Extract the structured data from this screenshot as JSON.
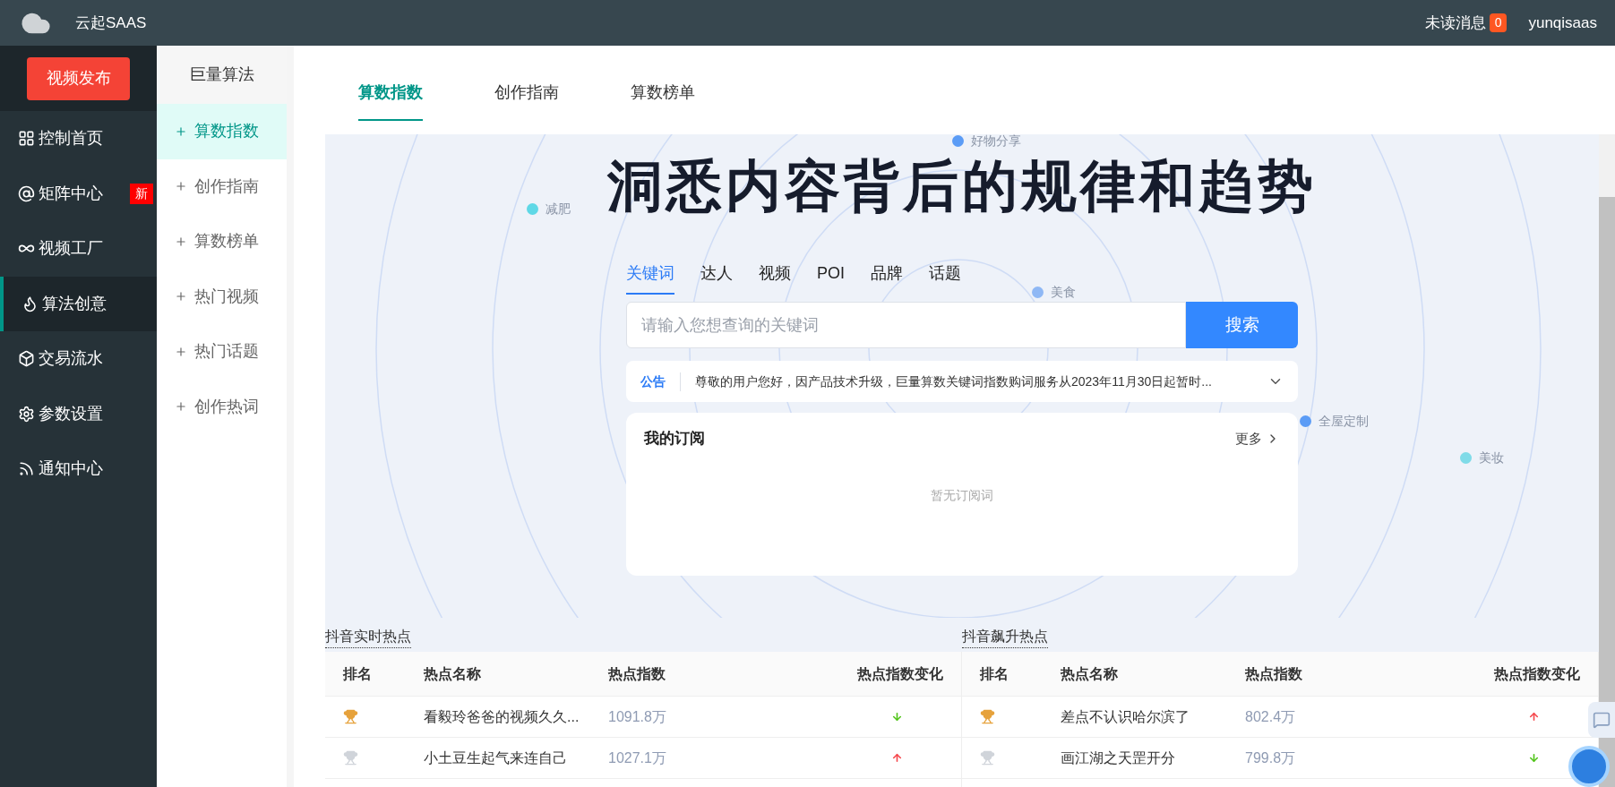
{
  "header": {
    "brand": "云起SAAS",
    "unread_label": "未读消息",
    "unread_count": "0",
    "user": "yunqisaas"
  },
  "sidebar": {
    "publish_button": "视频发布",
    "items": [
      {
        "label": "控制首页",
        "selected": false
      },
      {
        "label": "矩阵中心",
        "selected": false,
        "badge": "新"
      },
      {
        "label": "视频工厂",
        "selected": false
      },
      {
        "label": "算法创意",
        "selected": true
      },
      {
        "label": "交易流水",
        "selected": false
      },
      {
        "label": "参数设置",
        "selected": false
      },
      {
        "label": "通知中心",
        "selected": false
      }
    ]
  },
  "subnav": {
    "title": "巨量算法",
    "items": [
      {
        "label": "算数指数",
        "selected": true
      },
      {
        "label": "创作指南",
        "selected": false
      },
      {
        "label": "算数榜单",
        "selected": false
      },
      {
        "label": "热门视频",
        "selected": false
      },
      {
        "label": "热门话题",
        "selected": false
      },
      {
        "label": "创作热词",
        "selected": false
      }
    ]
  },
  "tabs": [
    {
      "label": "算数指数",
      "selected": true
    },
    {
      "label": "创作指南",
      "selected": false
    },
    {
      "label": "算数榜单",
      "selected": false
    }
  ],
  "hero": {
    "title": "洞悉内容背后的规律和趋势",
    "floating_tags": [
      {
        "label": "好物分享",
        "color": "#5b9cf6"
      },
      {
        "label": "减肥",
        "color": "#5fd8e6"
      },
      {
        "label": "美食",
        "color": "#8fb8f5"
      },
      {
        "label": "全屋定制",
        "color": "#5b9cf6"
      },
      {
        "label": "美妆",
        "color": "#7fdbe8"
      }
    ],
    "search_tabs": [
      {
        "label": "关键词",
        "selected": true
      },
      {
        "label": "达人",
        "selected": false
      },
      {
        "label": "视频",
        "selected": false
      },
      {
        "label": "POI",
        "selected": false
      },
      {
        "label": "品牌",
        "selected": false
      },
      {
        "label": "话题",
        "selected": false
      }
    ],
    "search_placeholder": "请输入您想查询的关键词",
    "search_button": "搜索",
    "notice": {
      "label": "公告",
      "text": "尊敬的用户您好，因产品技术升级，巨量算数关键词指数购词服务从2023年11月30日起暂时..."
    },
    "subscription": {
      "title": "我的订阅",
      "more": "更多",
      "empty": "暂无订阅词"
    }
  },
  "tables": [
    {
      "title": "抖音实时热点",
      "columns": [
        "排名",
        "热点名称",
        "热点指数",
        "热点指数变化"
      ],
      "rows": [
        {
          "name": "看毅玲爸爸的视频久久...",
          "index": "1091.8万",
          "rising": false
        },
        {
          "name": "小土豆生起气来连自己",
          "index": "1027.1万",
          "rising": true
        }
      ]
    },
    {
      "title": "抖音飙升热点",
      "columns": [
        "排名",
        "热点名称",
        "热点指数",
        "热点指数变化"
      ],
      "rows": [
        {
          "name": "差点不认识哈尔滨了",
          "index": "802.4万",
          "rising": true
        },
        {
          "name": "画江湖之天罡开分",
          "index": "799.8万",
          "rising": false
        }
      ]
    }
  ]
}
